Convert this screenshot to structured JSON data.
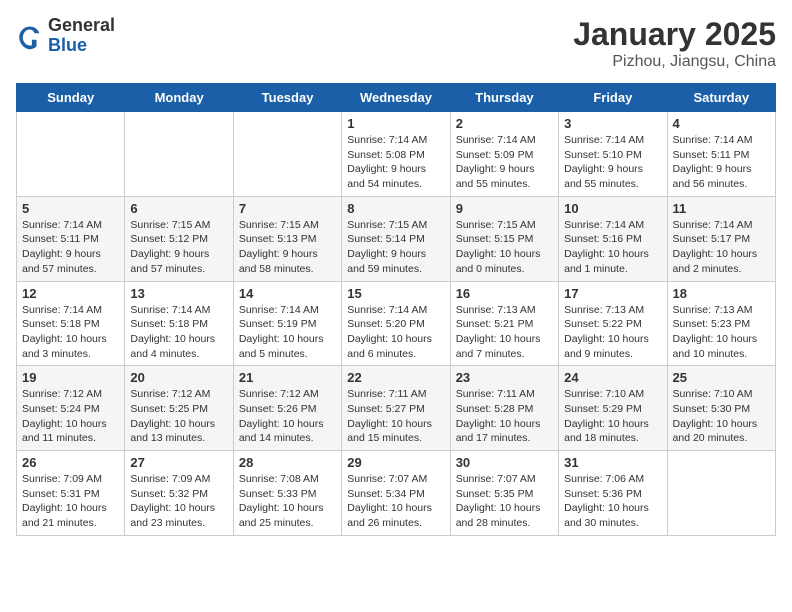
{
  "logo": {
    "general": "General",
    "blue": "Blue"
  },
  "title": "January 2025",
  "subtitle": "Pizhou, Jiangsu, China",
  "days_of_week": [
    "Sunday",
    "Monday",
    "Tuesday",
    "Wednesday",
    "Thursday",
    "Friday",
    "Saturday"
  ],
  "weeks": [
    [
      {
        "day": "",
        "info": ""
      },
      {
        "day": "",
        "info": ""
      },
      {
        "day": "",
        "info": ""
      },
      {
        "day": "1",
        "info": "Sunrise: 7:14 AM\nSunset: 5:08 PM\nDaylight: 9 hours\nand 54 minutes."
      },
      {
        "day": "2",
        "info": "Sunrise: 7:14 AM\nSunset: 5:09 PM\nDaylight: 9 hours\nand 55 minutes."
      },
      {
        "day": "3",
        "info": "Sunrise: 7:14 AM\nSunset: 5:10 PM\nDaylight: 9 hours\nand 55 minutes."
      },
      {
        "day": "4",
        "info": "Sunrise: 7:14 AM\nSunset: 5:11 PM\nDaylight: 9 hours\nand 56 minutes."
      }
    ],
    [
      {
        "day": "5",
        "info": "Sunrise: 7:14 AM\nSunset: 5:11 PM\nDaylight: 9 hours\nand 57 minutes."
      },
      {
        "day": "6",
        "info": "Sunrise: 7:15 AM\nSunset: 5:12 PM\nDaylight: 9 hours\nand 57 minutes."
      },
      {
        "day": "7",
        "info": "Sunrise: 7:15 AM\nSunset: 5:13 PM\nDaylight: 9 hours\nand 58 minutes."
      },
      {
        "day": "8",
        "info": "Sunrise: 7:15 AM\nSunset: 5:14 PM\nDaylight: 9 hours\nand 59 minutes."
      },
      {
        "day": "9",
        "info": "Sunrise: 7:15 AM\nSunset: 5:15 PM\nDaylight: 10 hours\nand 0 minutes."
      },
      {
        "day": "10",
        "info": "Sunrise: 7:14 AM\nSunset: 5:16 PM\nDaylight: 10 hours\nand 1 minute."
      },
      {
        "day": "11",
        "info": "Sunrise: 7:14 AM\nSunset: 5:17 PM\nDaylight: 10 hours\nand 2 minutes."
      }
    ],
    [
      {
        "day": "12",
        "info": "Sunrise: 7:14 AM\nSunset: 5:18 PM\nDaylight: 10 hours\nand 3 minutes."
      },
      {
        "day": "13",
        "info": "Sunrise: 7:14 AM\nSunset: 5:18 PM\nDaylight: 10 hours\nand 4 minutes."
      },
      {
        "day": "14",
        "info": "Sunrise: 7:14 AM\nSunset: 5:19 PM\nDaylight: 10 hours\nand 5 minutes."
      },
      {
        "day": "15",
        "info": "Sunrise: 7:14 AM\nSunset: 5:20 PM\nDaylight: 10 hours\nand 6 minutes."
      },
      {
        "day": "16",
        "info": "Sunrise: 7:13 AM\nSunset: 5:21 PM\nDaylight: 10 hours\nand 7 minutes."
      },
      {
        "day": "17",
        "info": "Sunrise: 7:13 AM\nSunset: 5:22 PM\nDaylight: 10 hours\nand 9 minutes."
      },
      {
        "day": "18",
        "info": "Sunrise: 7:13 AM\nSunset: 5:23 PM\nDaylight: 10 hours\nand 10 minutes."
      }
    ],
    [
      {
        "day": "19",
        "info": "Sunrise: 7:12 AM\nSunset: 5:24 PM\nDaylight: 10 hours\nand 11 minutes."
      },
      {
        "day": "20",
        "info": "Sunrise: 7:12 AM\nSunset: 5:25 PM\nDaylight: 10 hours\nand 13 minutes."
      },
      {
        "day": "21",
        "info": "Sunrise: 7:12 AM\nSunset: 5:26 PM\nDaylight: 10 hours\nand 14 minutes."
      },
      {
        "day": "22",
        "info": "Sunrise: 7:11 AM\nSunset: 5:27 PM\nDaylight: 10 hours\nand 15 minutes."
      },
      {
        "day": "23",
        "info": "Sunrise: 7:11 AM\nSunset: 5:28 PM\nDaylight: 10 hours\nand 17 minutes."
      },
      {
        "day": "24",
        "info": "Sunrise: 7:10 AM\nSunset: 5:29 PM\nDaylight: 10 hours\nand 18 minutes."
      },
      {
        "day": "25",
        "info": "Sunrise: 7:10 AM\nSunset: 5:30 PM\nDaylight: 10 hours\nand 20 minutes."
      }
    ],
    [
      {
        "day": "26",
        "info": "Sunrise: 7:09 AM\nSunset: 5:31 PM\nDaylight: 10 hours\nand 21 minutes."
      },
      {
        "day": "27",
        "info": "Sunrise: 7:09 AM\nSunset: 5:32 PM\nDaylight: 10 hours\nand 23 minutes."
      },
      {
        "day": "28",
        "info": "Sunrise: 7:08 AM\nSunset: 5:33 PM\nDaylight: 10 hours\nand 25 minutes."
      },
      {
        "day": "29",
        "info": "Sunrise: 7:07 AM\nSunset: 5:34 PM\nDaylight: 10 hours\nand 26 minutes."
      },
      {
        "day": "30",
        "info": "Sunrise: 7:07 AM\nSunset: 5:35 PM\nDaylight: 10 hours\nand 28 minutes."
      },
      {
        "day": "31",
        "info": "Sunrise: 7:06 AM\nSunset: 5:36 PM\nDaylight: 10 hours\nand 30 minutes."
      },
      {
        "day": "",
        "info": ""
      }
    ]
  ]
}
